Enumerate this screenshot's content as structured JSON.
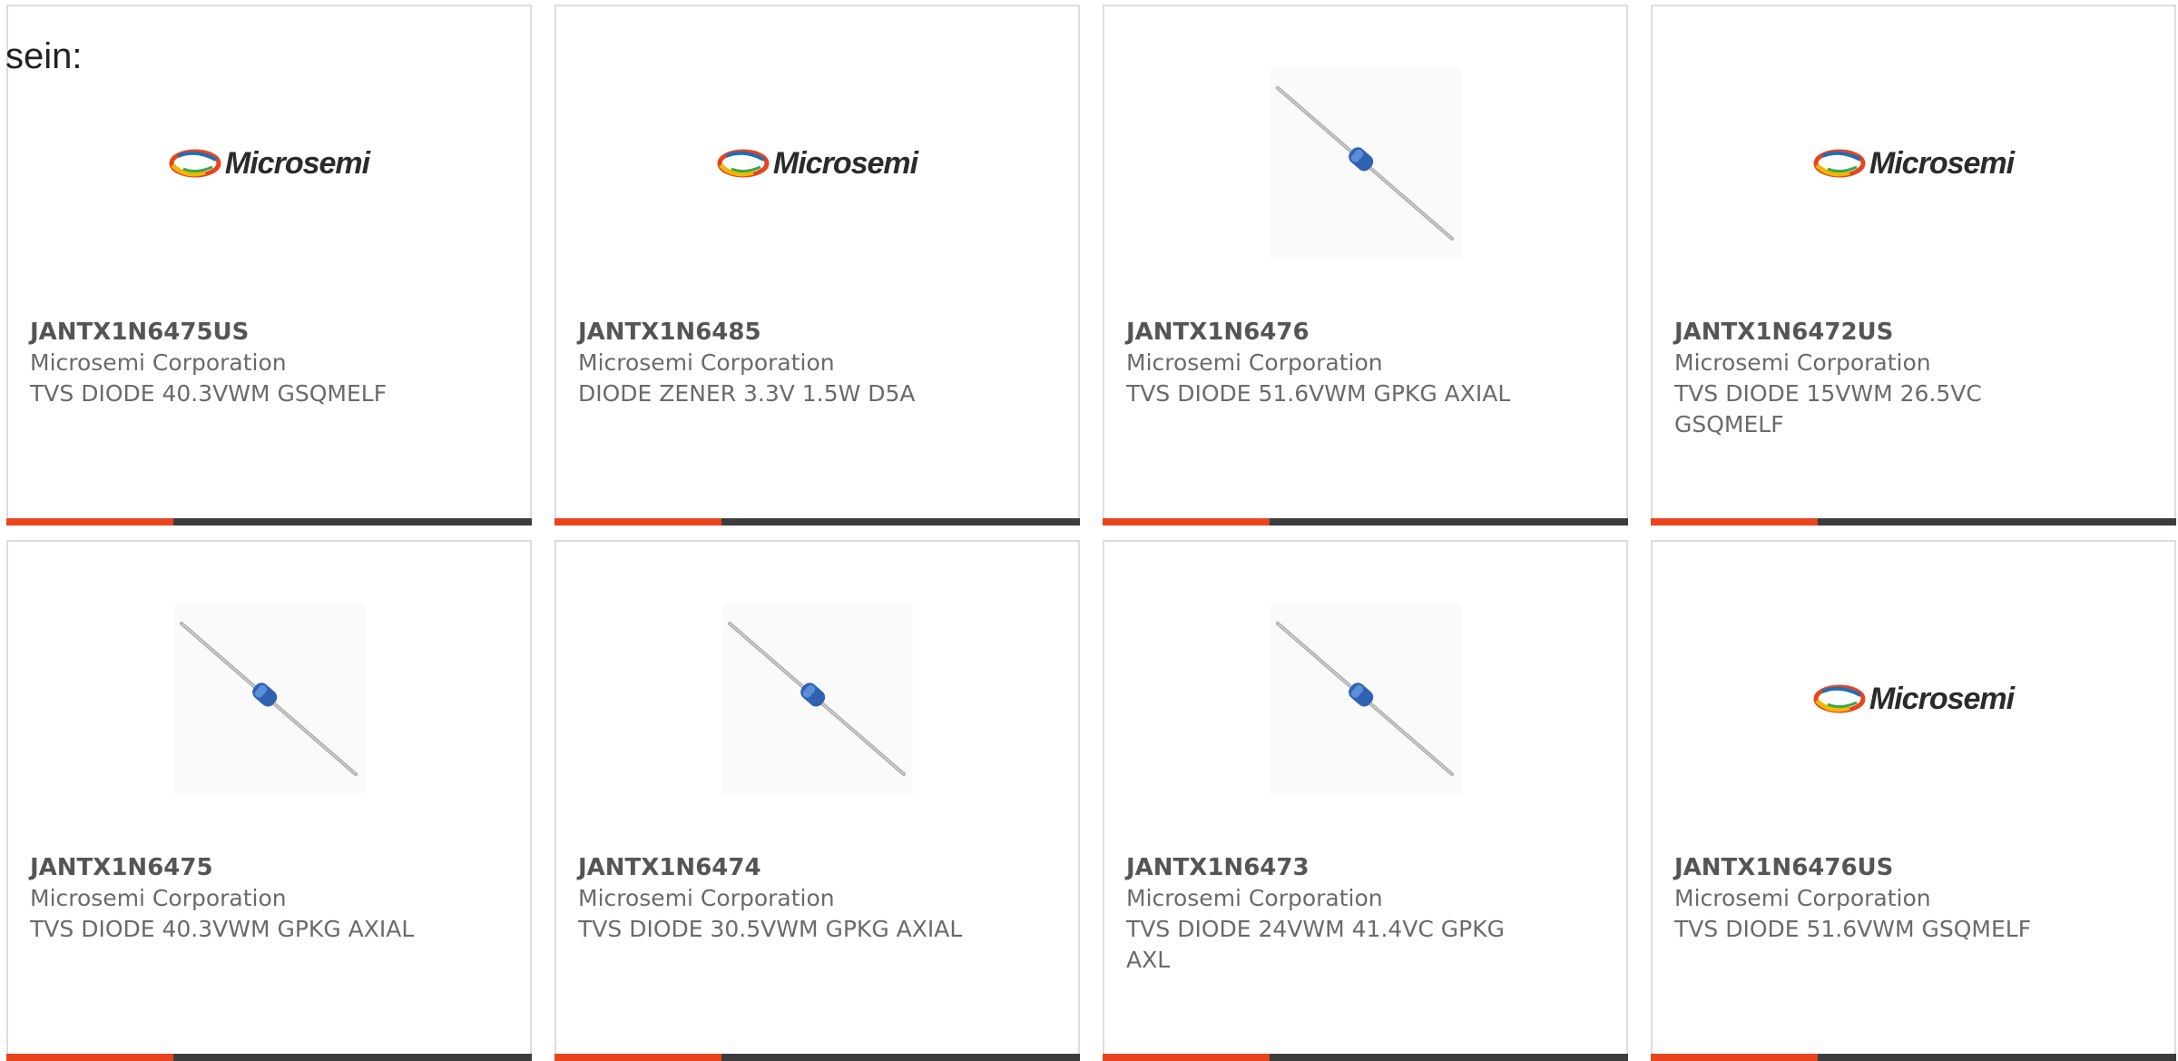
{
  "intro_text": "sein:",
  "colors": {
    "accent": "#e8451e",
    "bar_dark": "#3d3d3d",
    "border": "#dddddd"
  },
  "brand_logo_text": "Microsemi",
  "products": [
    {
      "part": "JANTX1N6475US",
      "manufacturer": "Microsemi Corporation",
      "description": "TVS DIODE 40.3VWM GSQMELF",
      "image": "microsemi-logo"
    },
    {
      "part": "JANTX1N6485",
      "manufacturer": "Microsemi Corporation",
      "description": "DIODE ZENER 3.3V 1.5W D5A",
      "image": "microsemi-logo"
    },
    {
      "part": "JANTX1N6476",
      "manufacturer": "Microsemi Corporation",
      "description": "TVS DIODE 51.6VWM GPKG AXIAL",
      "image": "axial-diode-photo"
    },
    {
      "part": "JANTX1N6472US",
      "manufacturer": "Microsemi Corporation",
      "description": "TVS DIODE 15VWM 26.5VC GSQMELF",
      "image": "microsemi-logo"
    },
    {
      "part": "JANTX1N6475",
      "manufacturer": "Microsemi Corporation",
      "description": "TVS DIODE 40.3VWM GPKG AXIAL",
      "image": "axial-diode-photo"
    },
    {
      "part": "JANTX1N6474",
      "manufacturer": "Microsemi Corporation",
      "description": "TVS DIODE 30.5VWM GPKG AXIAL",
      "image": "axial-diode-photo"
    },
    {
      "part": "JANTX1N6473",
      "manufacturer": "Microsemi Corporation",
      "description": "TVS DIODE 24VWM 41.4VC GPKG AXL",
      "image": "axial-diode-photo"
    },
    {
      "part": "JANTX1N6476US",
      "manufacturer": "Microsemi Corporation",
      "description": "TVS DIODE 51.6VWM GSQMELF",
      "image": "microsemi-logo"
    }
  ]
}
